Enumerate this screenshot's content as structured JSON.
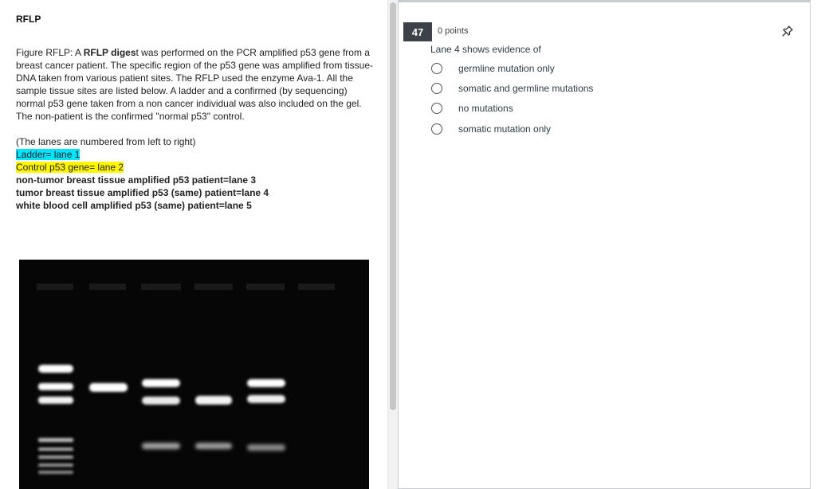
{
  "left": {
    "title": "RFLP",
    "figure_text": {
      "t1": "Figure RFLP:  A ",
      "t2": "RFLP diges",
      "t3": "t was performed on the PCR amplified p53 gene from a breast cancer patient.  The specific region of the p53 gene was amplified from tissue-DNA taken from various patient sites.  The RFLP used the enzyme Ava-1. All the sample tissue sites are listed below.  A ladder and a confirmed (by sequencing) normal p53 gene taken from a non cancer individual was also included on the gel.  The non-patient is the confirmed \"normal p53\" control."
    },
    "lanes_intro": "(The lanes are numbered from left to right)",
    "lane1": "Ladder= lane 1",
    "lane2": "Control p53 gene= lane 2",
    "lane3": "non-tumor breast tissue amplified p53  patient=lane 3",
    "lane4": "tumor breast tissue amplified p53 (same) patient=lane 4",
    "lane5": "white blood cell amplified p53 (same) patient=lane 5"
  },
  "question": {
    "number": "47",
    "points": "0 points",
    "prompt": "Lane 4 shows evidence of",
    "answers": [
      "germline mutation only",
      "somatic and germline mutations",
      "no mutations",
      "somatic mutation only"
    ]
  },
  "colors": {
    "cyan_highlight": "#00e5ff",
    "yellow_highlight": "#fff700",
    "number_badge": "#3c4247"
  },
  "icons": {
    "pin": "pin-icon",
    "radio": "radio-icon"
  }
}
